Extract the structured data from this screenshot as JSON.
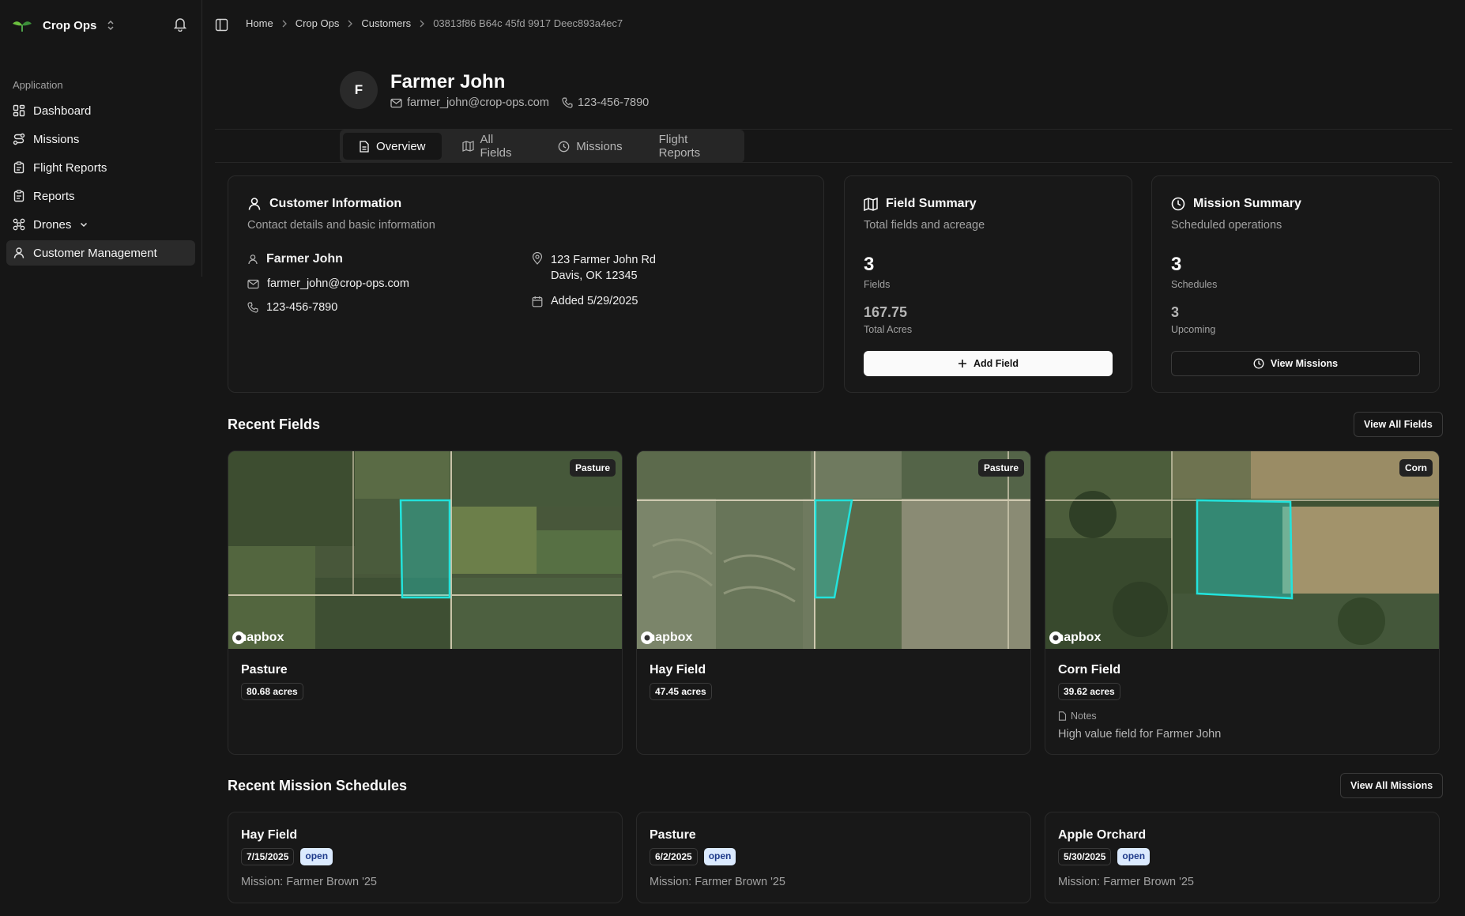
{
  "app": {
    "name": "Crop Ops"
  },
  "sidebar": {
    "group_label": "Application",
    "items": [
      {
        "label": "Dashboard",
        "icon": "dashboard-icon"
      },
      {
        "label": "Missions",
        "icon": "route-icon"
      },
      {
        "label": "Flight Reports",
        "icon": "clipboard-icon"
      },
      {
        "label": "Reports",
        "icon": "clipboard-icon"
      },
      {
        "label": "Drones",
        "icon": "drone-icon"
      },
      {
        "label": "Customer Management",
        "icon": "user-icon"
      }
    ]
  },
  "breadcrumb": [
    "Home",
    "Crop Ops",
    "Customers",
    "03813f86 B64c 45fd 9917 Deec893a4ec7"
  ],
  "customer": {
    "initial": "F",
    "name": "Farmer John",
    "email": "farmer_john@crop-ops.com",
    "phone": "123-456-7890"
  },
  "tabs": [
    "Overview",
    "All Fields",
    "Missions",
    "Flight Reports"
  ],
  "customer_info": {
    "title": "Customer Information",
    "subtitle": "Contact details and basic information",
    "name": "Farmer John",
    "email": "farmer_john@crop-ops.com",
    "phone": "123-456-7890",
    "address_line1": "123 Farmer John Rd",
    "address_line2": "Davis, OK 12345",
    "added": "Added 5/29/2025"
  },
  "field_summary": {
    "title": "Field Summary",
    "subtitle": "Total fields and acreage",
    "fields_count": "3",
    "fields_label": "Fields",
    "acres": "167.75",
    "acres_label": "Total Acres",
    "button": "Add Field"
  },
  "mission_summary": {
    "title": "Mission Summary",
    "subtitle": "Scheduled operations",
    "schedules_count": "3",
    "schedules_label": "Schedules",
    "upcoming_count": "3",
    "upcoming_label": "Upcoming",
    "button": "View Missions"
  },
  "recent_fields": {
    "title": "Recent Fields",
    "view_all": "View All Fields",
    "map_attribution": "mapbox",
    "items": [
      {
        "name": "Pasture",
        "acres": "80.68 acres",
        "crop": "Pasture",
        "notes_label": "",
        "notes": ""
      },
      {
        "name": "Hay Field",
        "acres": "47.45 acres",
        "crop": "Pasture",
        "notes_label": "",
        "notes": ""
      },
      {
        "name": "Corn Field",
        "acres": "39.62 acres",
        "crop": "Corn",
        "notes_label": "Notes",
        "notes": "High value field for Farmer John"
      }
    ]
  },
  "recent_missions": {
    "title": "Recent Mission Schedules",
    "view_all": "View All Missions",
    "items": [
      {
        "name": "Hay Field",
        "date": "7/15/2025",
        "status": "open",
        "mission": "Mission: Farmer Brown '25"
      },
      {
        "name": "Pasture",
        "date": "6/2/2025",
        "status": "open",
        "mission": "Mission: Farmer Brown '25"
      },
      {
        "name": "Apple Orchard",
        "date": "5/30/2025",
        "status": "open",
        "mission": "Mission: Farmer Brown '25"
      }
    ]
  },
  "colors": {
    "field_outline": "#22e3dc",
    "status_open_bg": "#dbeafe"
  }
}
